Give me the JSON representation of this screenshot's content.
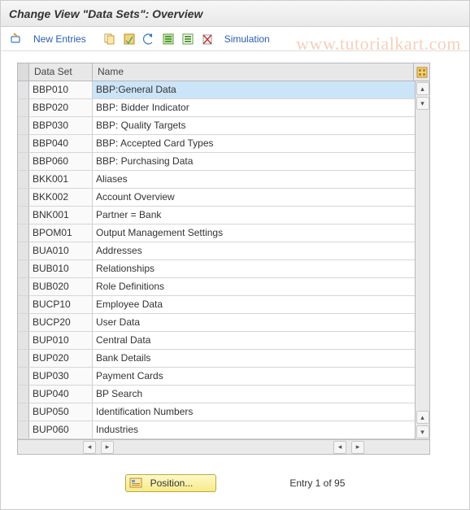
{
  "header": {
    "title": "Change View \"Data Sets\": Overview"
  },
  "toolbar": {
    "new_entries": "New Entries",
    "simulation": "Simulation"
  },
  "table": {
    "col1": "Data Set",
    "col2": "Name",
    "rows": [
      {
        "code": "BBP010",
        "name": "BBP:General Data",
        "selected": true
      },
      {
        "code": "BBP020",
        "name": "BBP: Bidder Indicator"
      },
      {
        "code": "BBP030",
        "name": "BBP: Quality Targets"
      },
      {
        "code": "BBP040",
        "name": "BBP: Accepted Card Types"
      },
      {
        "code": "BBP060",
        "name": "BBP: Purchasing Data"
      },
      {
        "code": "BKK001",
        "name": "Aliases"
      },
      {
        "code": "BKK002",
        "name": "Account Overview"
      },
      {
        "code": "BNK001",
        "name": "Partner = Bank"
      },
      {
        "code": "BPOM01",
        "name": "Output Management Settings"
      },
      {
        "code": "BUA010",
        "name": "Addresses"
      },
      {
        "code": "BUB010",
        "name": "Relationships"
      },
      {
        "code": "BUB020",
        "name": "Role Definitions"
      },
      {
        "code": "BUCP10",
        "name": "Employee Data"
      },
      {
        "code": "BUCP20",
        "name": "User Data"
      },
      {
        "code": "BUP010",
        "name": "Central Data"
      },
      {
        "code": "BUP020",
        "name": "Bank Details"
      },
      {
        "code": "BUP030",
        "name": "Payment Cards"
      },
      {
        "code": "BUP040",
        "name": "BP Search"
      },
      {
        "code": "BUP050",
        "name": "Identification Numbers"
      },
      {
        "code": "BUP060",
        "name": "Industries"
      }
    ]
  },
  "footer": {
    "position_btn": "Position...",
    "entry_text": "Entry 1 of 95"
  },
  "watermark": "www.tutorialkart.com"
}
